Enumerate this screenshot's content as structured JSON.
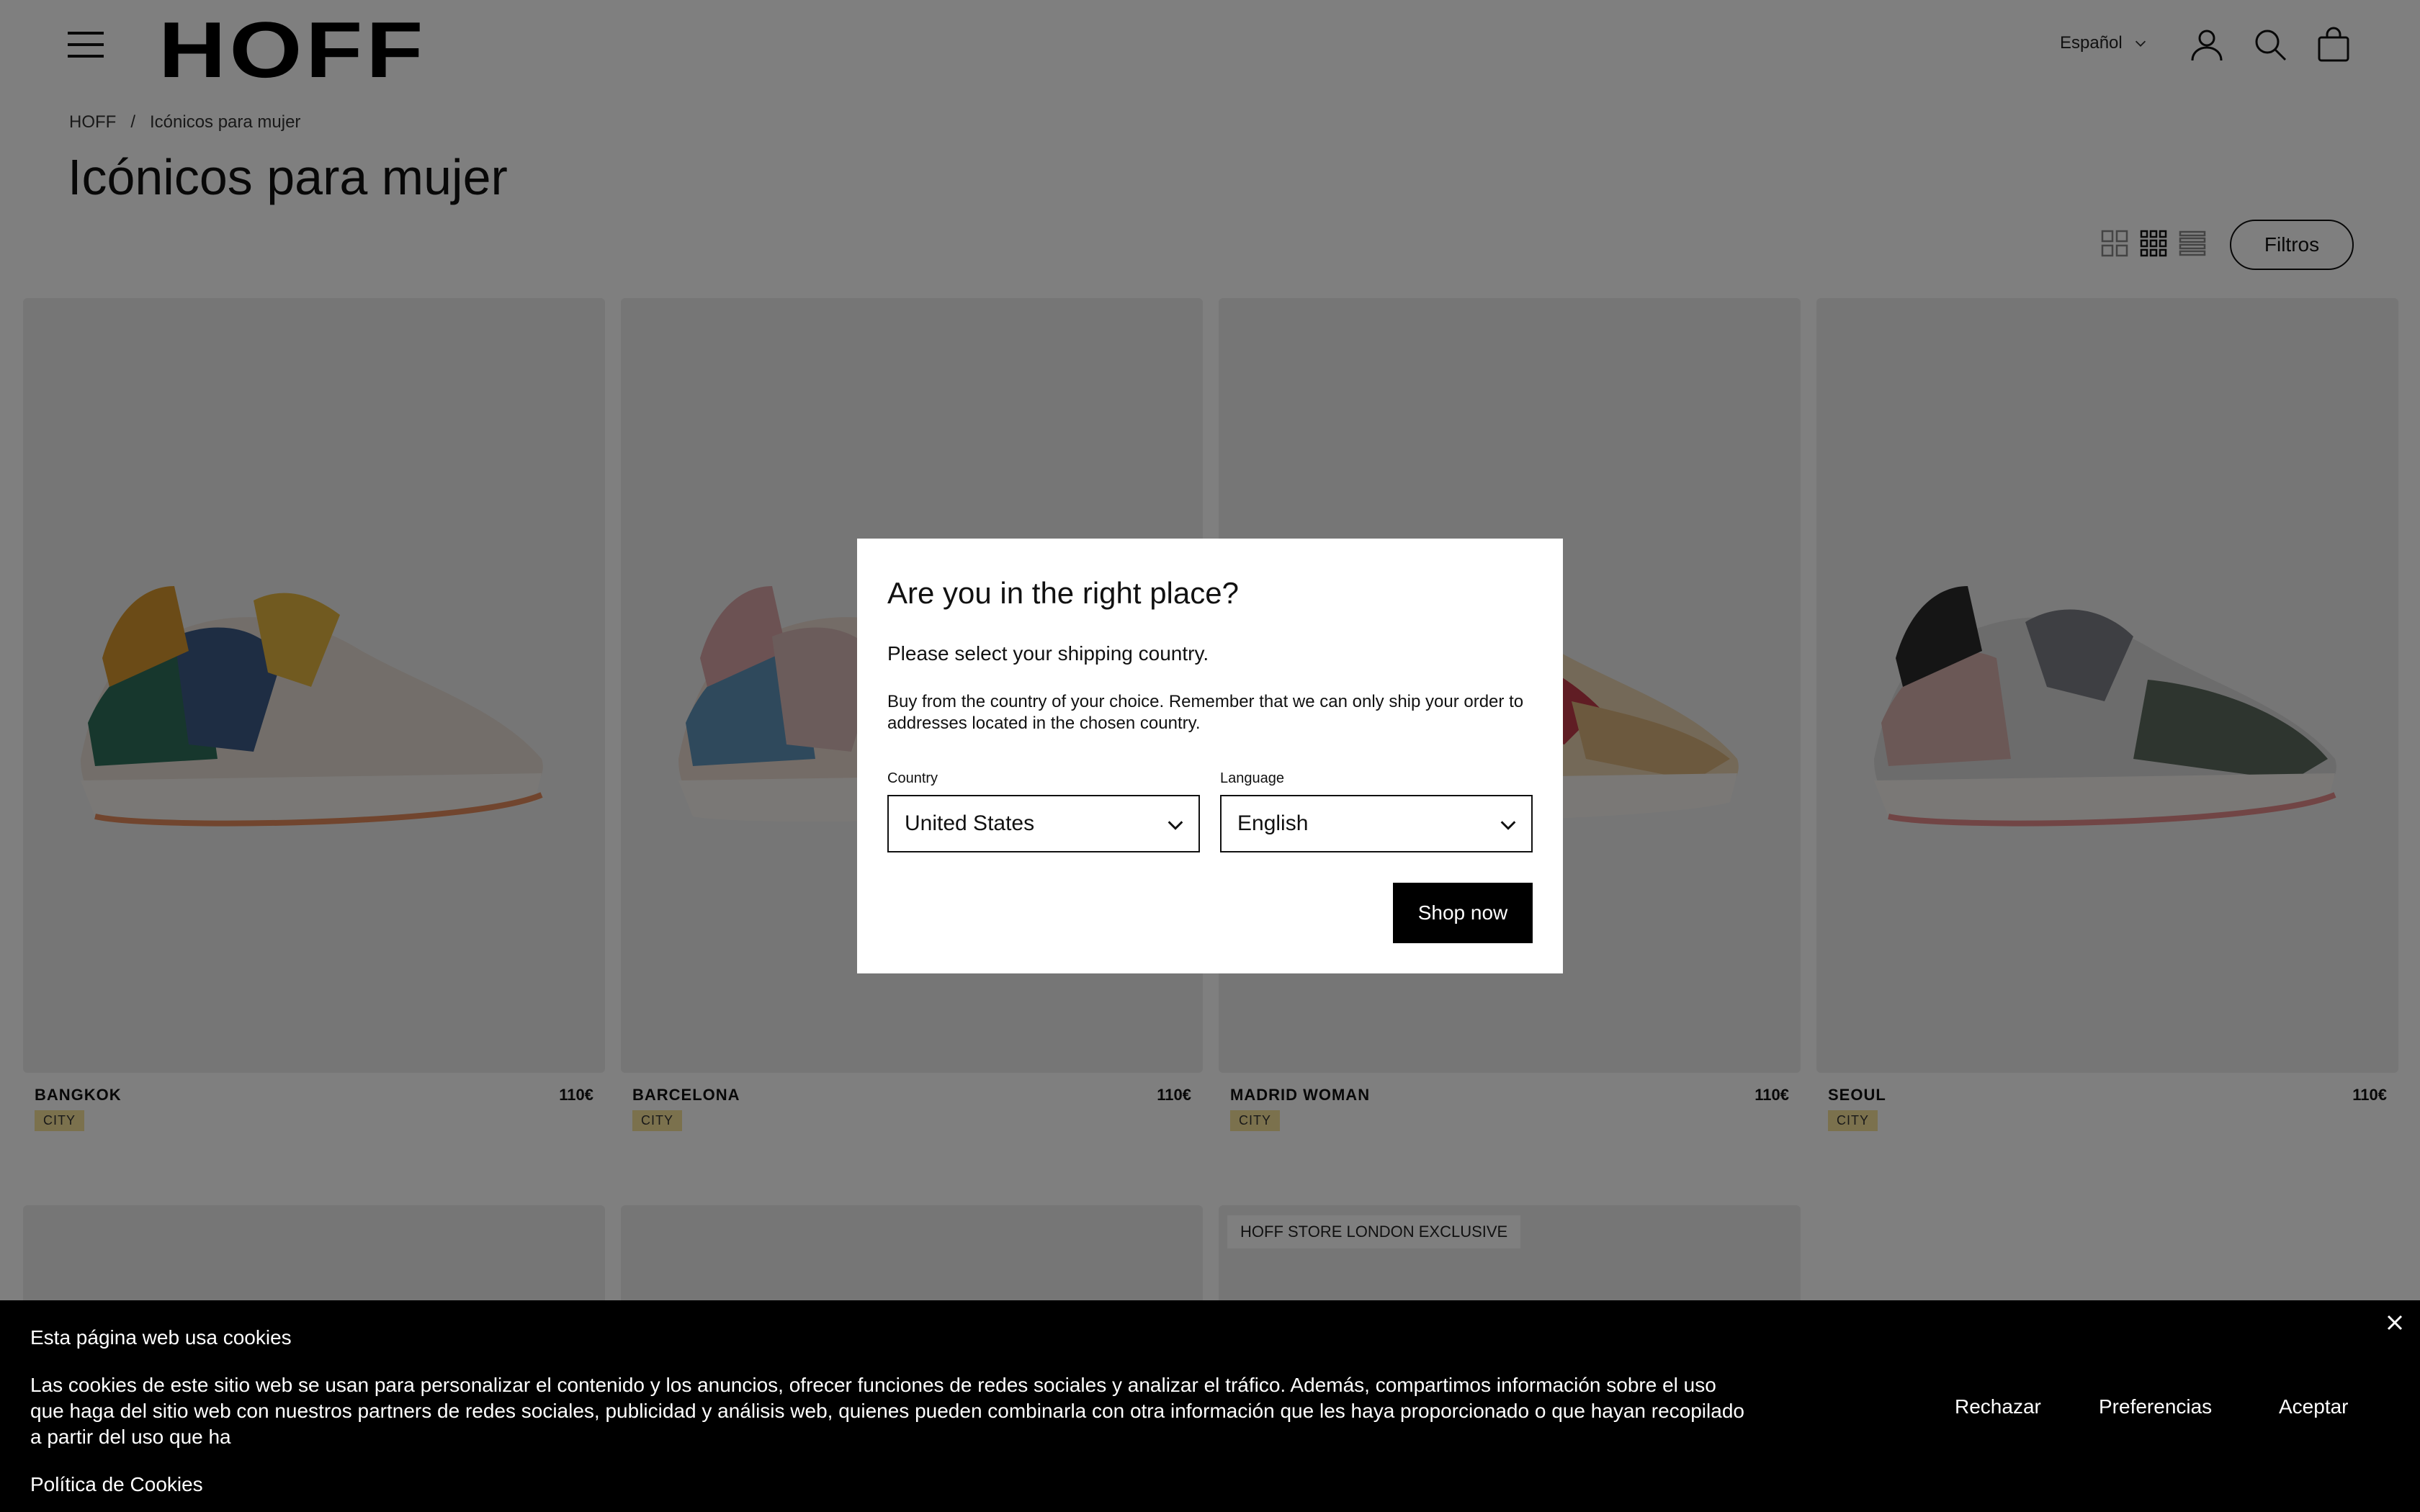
{
  "header": {
    "logo": "HOFF",
    "language": "Español"
  },
  "breadcrumb": {
    "home": "HOFF",
    "separator": "/",
    "current": "Icónicos para mujer"
  },
  "page_title": "Icónicos para mujer",
  "toolbar": {
    "filters_label": "Filtros"
  },
  "products": [
    {
      "name": "BANGKOK",
      "price": "110€",
      "tag": "CITY"
    },
    {
      "name": "BARCELONA",
      "price": "110€",
      "tag": "CITY"
    },
    {
      "name": "MADRID WOMAN",
      "price": "110€",
      "tag": "CITY"
    },
    {
      "name": "SEOUL",
      "price": "110€",
      "tag": "CITY"
    }
  ],
  "row2": {
    "exclusive_label": "HOFF STORE LONDON EXCLUSIVE"
  },
  "modal": {
    "title": "Are you in the right place?",
    "subtitle": "Please select your shipping country.",
    "body": "Buy from the country of your choice. Remember that we can only ship your order to addresses located in the chosen country.",
    "country_label": "Country",
    "country_value": "United States",
    "language_label": "Language",
    "language_value": "English",
    "submit_label": "Shop now"
  },
  "cookie": {
    "title": "Esta página web usa cookies",
    "text": "Las cookies de este sitio web se usan para personalizar el contenido y los anuncios, ofrecer funciones de redes sociales y analizar el tráfico. Además, compartimos información sobre el uso que haga del sitio web con nuestros partners de redes sociales, publicidad y análisis web, quienes pueden combinarla con otra información que les haya proporcionado o que hayan recopilado a partir del uso que ha",
    "policy_link": "Política de Cookies",
    "reject_label": "Rechazar",
    "preferences_label": "Preferencias",
    "accept_label": "Aceptar"
  },
  "colors": {
    "tag_background": "#f7e29a",
    "overlay": "rgba(0,0,0,0.5)",
    "primary_button": "#000000"
  }
}
